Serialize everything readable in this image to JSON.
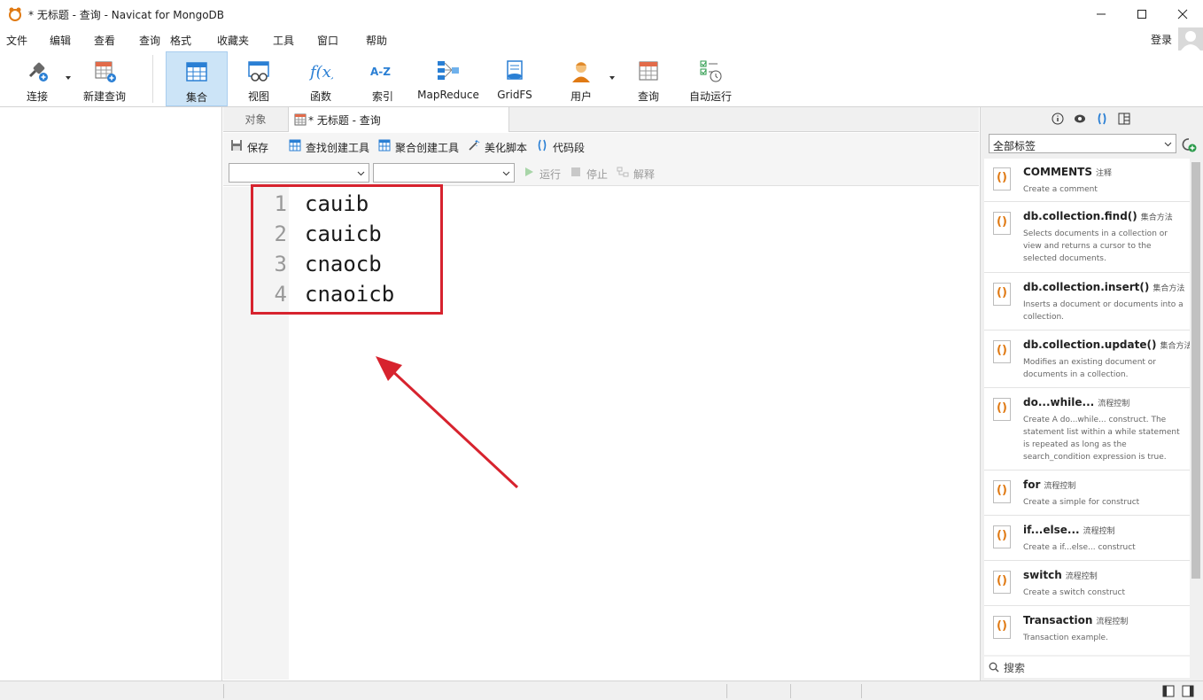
{
  "window": {
    "title": "* 无标题 - 查询 - Navicat for MongoDB"
  },
  "menu": {
    "items": [
      "文件",
      "编辑",
      "查看",
      "查询",
      "格式",
      "收藏夹",
      "工具",
      "窗口",
      "帮助"
    ],
    "login": "登录"
  },
  "toolbar": {
    "buttons": [
      {
        "label": "连接",
        "icon": "plug-icon"
      },
      {
        "label": "新建查询",
        "icon": "new-query-icon"
      },
      {
        "label": "集合",
        "icon": "collection-icon",
        "active": true
      },
      {
        "label": "视图",
        "icon": "view-icon"
      },
      {
        "label": "函数",
        "icon": "function-icon"
      },
      {
        "label": "索引",
        "icon": "index-icon"
      },
      {
        "label": "MapReduce",
        "icon": "mapreduce-icon"
      },
      {
        "label": "GridFS",
        "icon": "gridfs-icon"
      },
      {
        "label": "用户",
        "icon": "user-icon"
      },
      {
        "label": "查询",
        "icon": "query-icon"
      },
      {
        "label": "自动运行",
        "icon": "automation-icon"
      }
    ]
  },
  "tabs": {
    "objects": "对象",
    "query": "* 无标题 - 查询"
  },
  "query_toolbar": {
    "save": "保存",
    "find_builder": "查找创建工具",
    "aggregate_builder": "聚合创建工具",
    "beautify": "美化脚本",
    "snippet": "代码段",
    "run": "运行",
    "stop": "停止",
    "explain": "解释"
  },
  "editor": {
    "lines": [
      {
        "num": "1",
        "text": "cauib"
      },
      {
        "num": "2",
        "text": "cauicb"
      },
      {
        "num": "3",
        "text": "cnaocb"
      },
      {
        "num": "4",
        "text": "cnaoicb"
      }
    ]
  },
  "right_panel": {
    "filter": "全部标签",
    "snippets": [
      {
        "title": "COMMENTS",
        "tag": "注释",
        "desc": "Create a comment"
      },
      {
        "title": "db.collection.find()",
        "tag": "集合方法",
        "desc": "Selects documents in a collection or view and returns a cursor to the selected documents."
      },
      {
        "title": "db.collection.insert()",
        "tag": "集合方法",
        "desc": "Inserts a document or documents into a collection."
      },
      {
        "title": "db.collection.update()",
        "tag": "集合方法",
        "desc": "Modifies an existing document or documents in a collection."
      },
      {
        "title": "do...while...",
        "tag": "流程控制",
        "desc": "Create A do...while... construct. The statement list within a while statement is repeated as long as the search_condition expression is true."
      },
      {
        "title": "for",
        "tag": "流程控制",
        "desc": "Create a simple for construct"
      },
      {
        "title": "if...else...",
        "tag": "流程控制",
        "desc": "Create a if...else... construct"
      },
      {
        "title": "switch",
        "tag": "流程控制",
        "desc": "Create a switch construct"
      },
      {
        "title": "Transaction",
        "tag": "流程控制",
        "desc": "Transaction example."
      }
    ],
    "search_placeholder": "搜索"
  },
  "colors": {
    "accent": "#1e7ad6",
    "highlight": "#d7232e",
    "active_bg": "#cce4f7"
  }
}
